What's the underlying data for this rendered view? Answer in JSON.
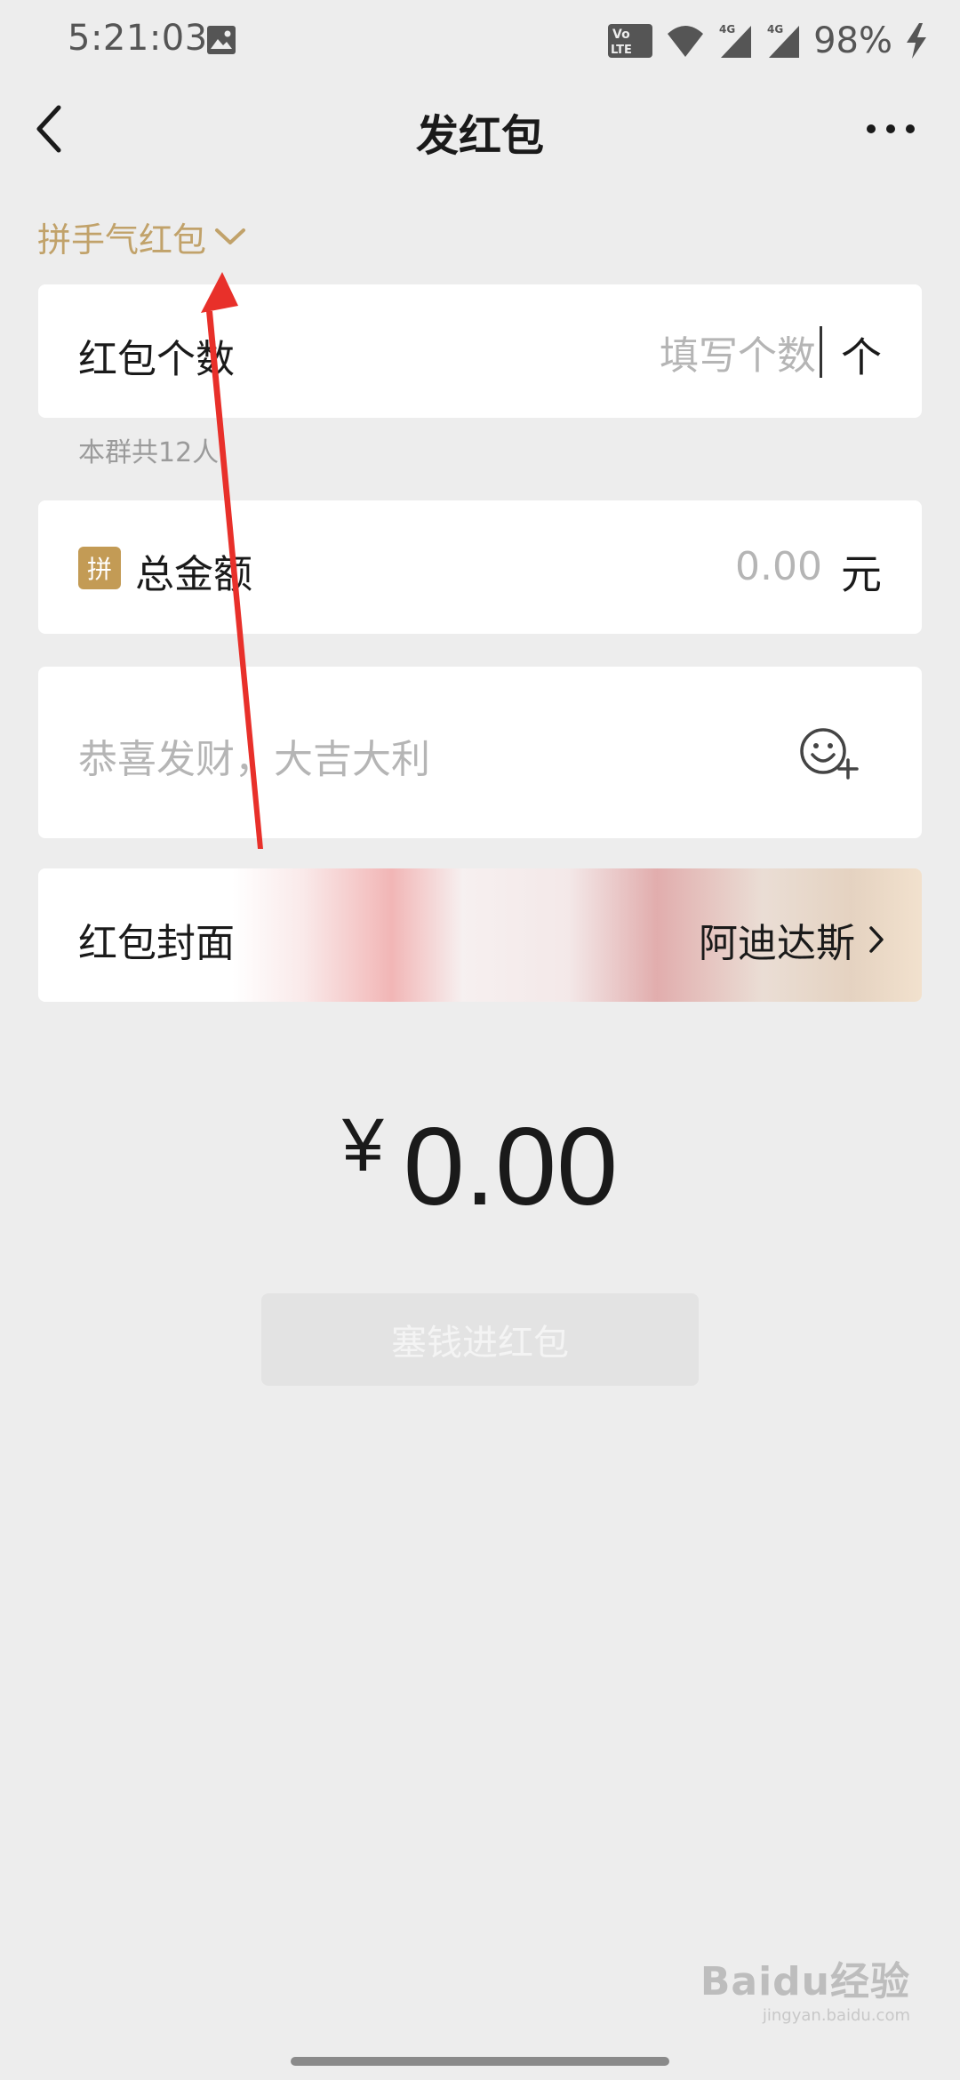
{
  "status_bar": {
    "time": "5:21:03",
    "battery": "98%",
    "volte_line1": "Vo",
    "volte_line2": "LTE",
    "net1": "4G",
    "net2": "4G"
  },
  "header": {
    "title": "发红包"
  },
  "type_selector": {
    "label": "拼手气红包"
  },
  "count_field": {
    "label": "红包个数",
    "placeholder": "填写个数",
    "unit": "个",
    "note": "本群共12人"
  },
  "amount_field": {
    "badge": "拼",
    "label": "总金额",
    "placeholder": "0.00",
    "unit": "元"
  },
  "message_field": {
    "placeholder": "恭喜发财，大吉大利"
  },
  "cover": {
    "label": "红包封面",
    "value": "阿迪达斯"
  },
  "amount_display": {
    "currency": "¥",
    "value": "0.00"
  },
  "submit": {
    "label": "塞钱进红包"
  },
  "watermark": {
    "main": "Baidu经验",
    "sub": "jingyan.baidu.com"
  },
  "colors": {
    "accent_gold": "#c1a26a",
    "badge_gold": "#c39b55",
    "annotation_red": "#e8302a",
    "background": "#ededed"
  }
}
